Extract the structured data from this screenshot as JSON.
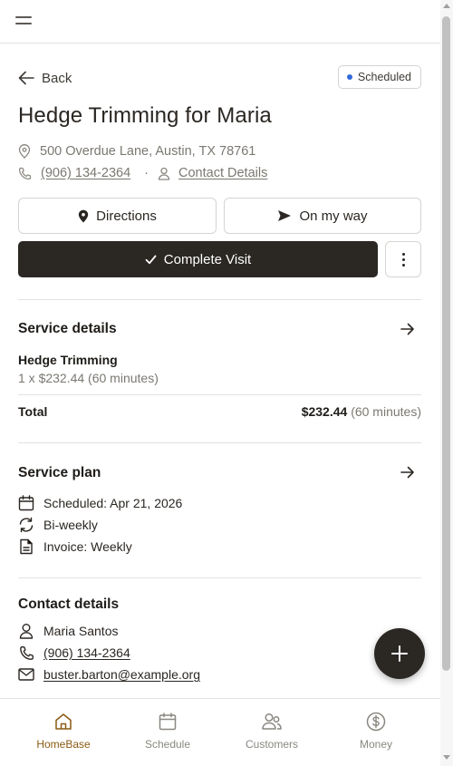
{
  "header": {
    "menu_icon": "hamburger-menu-icon"
  },
  "nav": {
    "back_label": "Back"
  },
  "status": {
    "label": "Scheduled",
    "color": "#2f6bd9"
  },
  "job": {
    "title": "Hedge Trimming for Maria",
    "address": "500 Overdue Lane, Austin, TX 78761",
    "phone": "(906) 134-2364",
    "contact_link": "Contact Details"
  },
  "actions": {
    "directions_label": "Directions",
    "on_my_way_label": "On my way",
    "complete_label": "Complete Visit"
  },
  "service_details": {
    "heading": "Service details",
    "item_name": "Hedge Trimming",
    "item_detail": "1 x $232.44 (60 minutes)",
    "total_label": "Total",
    "total_amount": "$232.44",
    "total_duration": "(60 minutes)"
  },
  "service_plan": {
    "heading": "Service plan",
    "scheduled": "Scheduled: Apr 21, 2026",
    "frequency": "Bi-weekly",
    "invoice": "Invoice: Weekly"
  },
  "contact": {
    "heading": "Contact details",
    "name": "Maria Santos",
    "phone": "(906) 134-2364",
    "email": "buster.barton@example.org"
  },
  "bottom_nav": {
    "items": [
      {
        "label": "HomeBase",
        "icon": "home-icon",
        "active": true
      },
      {
        "label": "Schedule",
        "icon": "calendar-icon",
        "active": false
      },
      {
        "label": "Customers",
        "icon": "customers-icon",
        "active": false
      },
      {
        "label": "Money",
        "icon": "dollar-icon",
        "active": false
      }
    ]
  },
  "colors": {
    "primary_dark": "#2b2824",
    "accent_brown": "#8a5a12",
    "muted_text": "#7b7872"
  }
}
